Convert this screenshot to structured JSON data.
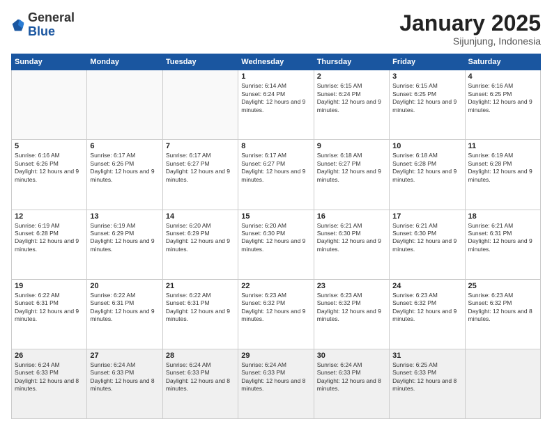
{
  "header": {
    "logo_general": "General",
    "logo_blue": "Blue",
    "month": "January 2025",
    "location": "Sijunjung, Indonesia"
  },
  "days_of_week": [
    "Sunday",
    "Monday",
    "Tuesday",
    "Wednesday",
    "Thursday",
    "Friday",
    "Saturday"
  ],
  "weeks": [
    [
      {
        "day": "",
        "content": ""
      },
      {
        "day": "",
        "content": ""
      },
      {
        "day": "",
        "content": ""
      },
      {
        "day": "1",
        "content": "Sunrise: 6:14 AM\nSunset: 6:24 PM\nDaylight: 12 hours and 9 minutes."
      },
      {
        "day": "2",
        "content": "Sunrise: 6:15 AM\nSunset: 6:24 PM\nDaylight: 12 hours and 9 minutes."
      },
      {
        "day": "3",
        "content": "Sunrise: 6:15 AM\nSunset: 6:25 PM\nDaylight: 12 hours and 9 minutes."
      },
      {
        "day": "4",
        "content": "Sunrise: 6:16 AM\nSunset: 6:25 PM\nDaylight: 12 hours and 9 minutes."
      }
    ],
    [
      {
        "day": "5",
        "content": "Sunrise: 6:16 AM\nSunset: 6:26 PM\nDaylight: 12 hours and 9 minutes."
      },
      {
        "day": "6",
        "content": "Sunrise: 6:17 AM\nSunset: 6:26 PM\nDaylight: 12 hours and 9 minutes."
      },
      {
        "day": "7",
        "content": "Sunrise: 6:17 AM\nSunset: 6:27 PM\nDaylight: 12 hours and 9 minutes."
      },
      {
        "day": "8",
        "content": "Sunrise: 6:17 AM\nSunset: 6:27 PM\nDaylight: 12 hours and 9 minutes."
      },
      {
        "day": "9",
        "content": "Sunrise: 6:18 AM\nSunset: 6:27 PM\nDaylight: 12 hours and 9 minutes."
      },
      {
        "day": "10",
        "content": "Sunrise: 6:18 AM\nSunset: 6:28 PM\nDaylight: 12 hours and 9 minutes."
      },
      {
        "day": "11",
        "content": "Sunrise: 6:19 AM\nSunset: 6:28 PM\nDaylight: 12 hours and 9 minutes."
      }
    ],
    [
      {
        "day": "12",
        "content": "Sunrise: 6:19 AM\nSunset: 6:28 PM\nDaylight: 12 hours and 9 minutes."
      },
      {
        "day": "13",
        "content": "Sunrise: 6:19 AM\nSunset: 6:29 PM\nDaylight: 12 hours and 9 minutes."
      },
      {
        "day": "14",
        "content": "Sunrise: 6:20 AM\nSunset: 6:29 PM\nDaylight: 12 hours and 9 minutes."
      },
      {
        "day": "15",
        "content": "Sunrise: 6:20 AM\nSunset: 6:30 PM\nDaylight: 12 hours and 9 minutes."
      },
      {
        "day": "16",
        "content": "Sunrise: 6:21 AM\nSunset: 6:30 PM\nDaylight: 12 hours and 9 minutes."
      },
      {
        "day": "17",
        "content": "Sunrise: 6:21 AM\nSunset: 6:30 PM\nDaylight: 12 hours and 9 minutes."
      },
      {
        "day": "18",
        "content": "Sunrise: 6:21 AM\nSunset: 6:31 PM\nDaylight: 12 hours and 9 minutes."
      }
    ],
    [
      {
        "day": "19",
        "content": "Sunrise: 6:22 AM\nSunset: 6:31 PM\nDaylight: 12 hours and 9 minutes."
      },
      {
        "day": "20",
        "content": "Sunrise: 6:22 AM\nSunset: 6:31 PM\nDaylight: 12 hours and 9 minutes."
      },
      {
        "day": "21",
        "content": "Sunrise: 6:22 AM\nSunset: 6:31 PM\nDaylight: 12 hours and 9 minutes."
      },
      {
        "day": "22",
        "content": "Sunrise: 6:23 AM\nSunset: 6:32 PM\nDaylight: 12 hours and 9 minutes."
      },
      {
        "day": "23",
        "content": "Sunrise: 6:23 AM\nSunset: 6:32 PM\nDaylight: 12 hours and 9 minutes."
      },
      {
        "day": "24",
        "content": "Sunrise: 6:23 AM\nSunset: 6:32 PM\nDaylight: 12 hours and 9 minutes."
      },
      {
        "day": "25",
        "content": "Sunrise: 6:23 AM\nSunset: 6:32 PM\nDaylight: 12 hours and 8 minutes."
      }
    ],
    [
      {
        "day": "26",
        "content": "Sunrise: 6:24 AM\nSunset: 6:33 PM\nDaylight: 12 hours and 8 minutes."
      },
      {
        "day": "27",
        "content": "Sunrise: 6:24 AM\nSunset: 6:33 PM\nDaylight: 12 hours and 8 minutes."
      },
      {
        "day": "28",
        "content": "Sunrise: 6:24 AM\nSunset: 6:33 PM\nDaylight: 12 hours and 8 minutes."
      },
      {
        "day": "29",
        "content": "Sunrise: 6:24 AM\nSunset: 6:33 PM\nDaylight: 12 hours and 8 minutes."
      },
      {
        "day": "30",
        "content": "Sunrise: 6:24 AM\nSunset: 6:33 PM\nDaylight: 12 hours and 8 minutes."
      },
      {
        "day": "31",
        "content": "Sunrise: 6:25 AM\nSunset: 6:33 PM\nDaylight: 12 hours and 8 minutes."
      },
      {
        "day": "",
        "content": ""
      }
    ]
  ]
}
